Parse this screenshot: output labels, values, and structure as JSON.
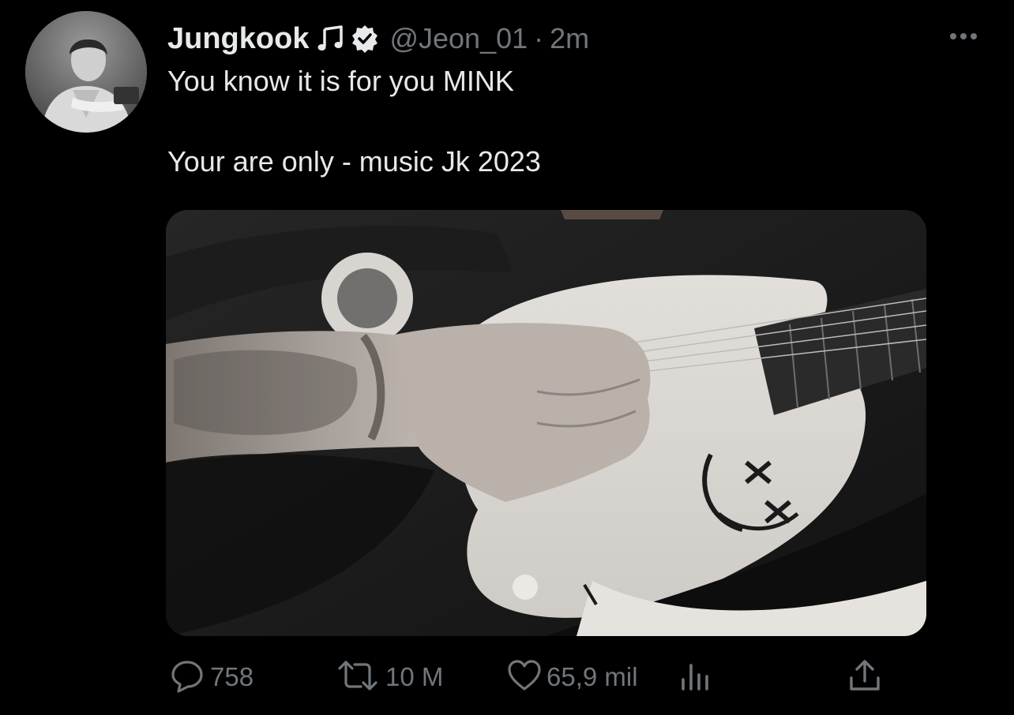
{
  "tweet": {
    "display_name": "Jungkook",
    "name_emoji_icon": "music-note-icon",
    "verified_icon": "verified-badge-icon",
    "handle": "@Jeon_01",
    "separator": "·",
    "timestamp": "2m",
    "text_line_1": "You know it is for you MINK",
    "text_line_2": "Your are only - music Jk 2023"
  },
  "actions": {
    "reply_count": "758",
    "retweet_count": "10 M",
    "like_count": "65,9 mil"
  },
  "icons": {
    "more": "more-horizontal-icon",
    "reply": "reply-icon",
    "retweet": "retweet-icon",
    "like": "heart-icon",
    "views": "views-chart-icon",
    "share": "share-icon"
  },
  "colors": {
    "background": "#000000",
    "primary_text": "#e7e9ea",
    "secondary_text": "#71767b"
  }
}
